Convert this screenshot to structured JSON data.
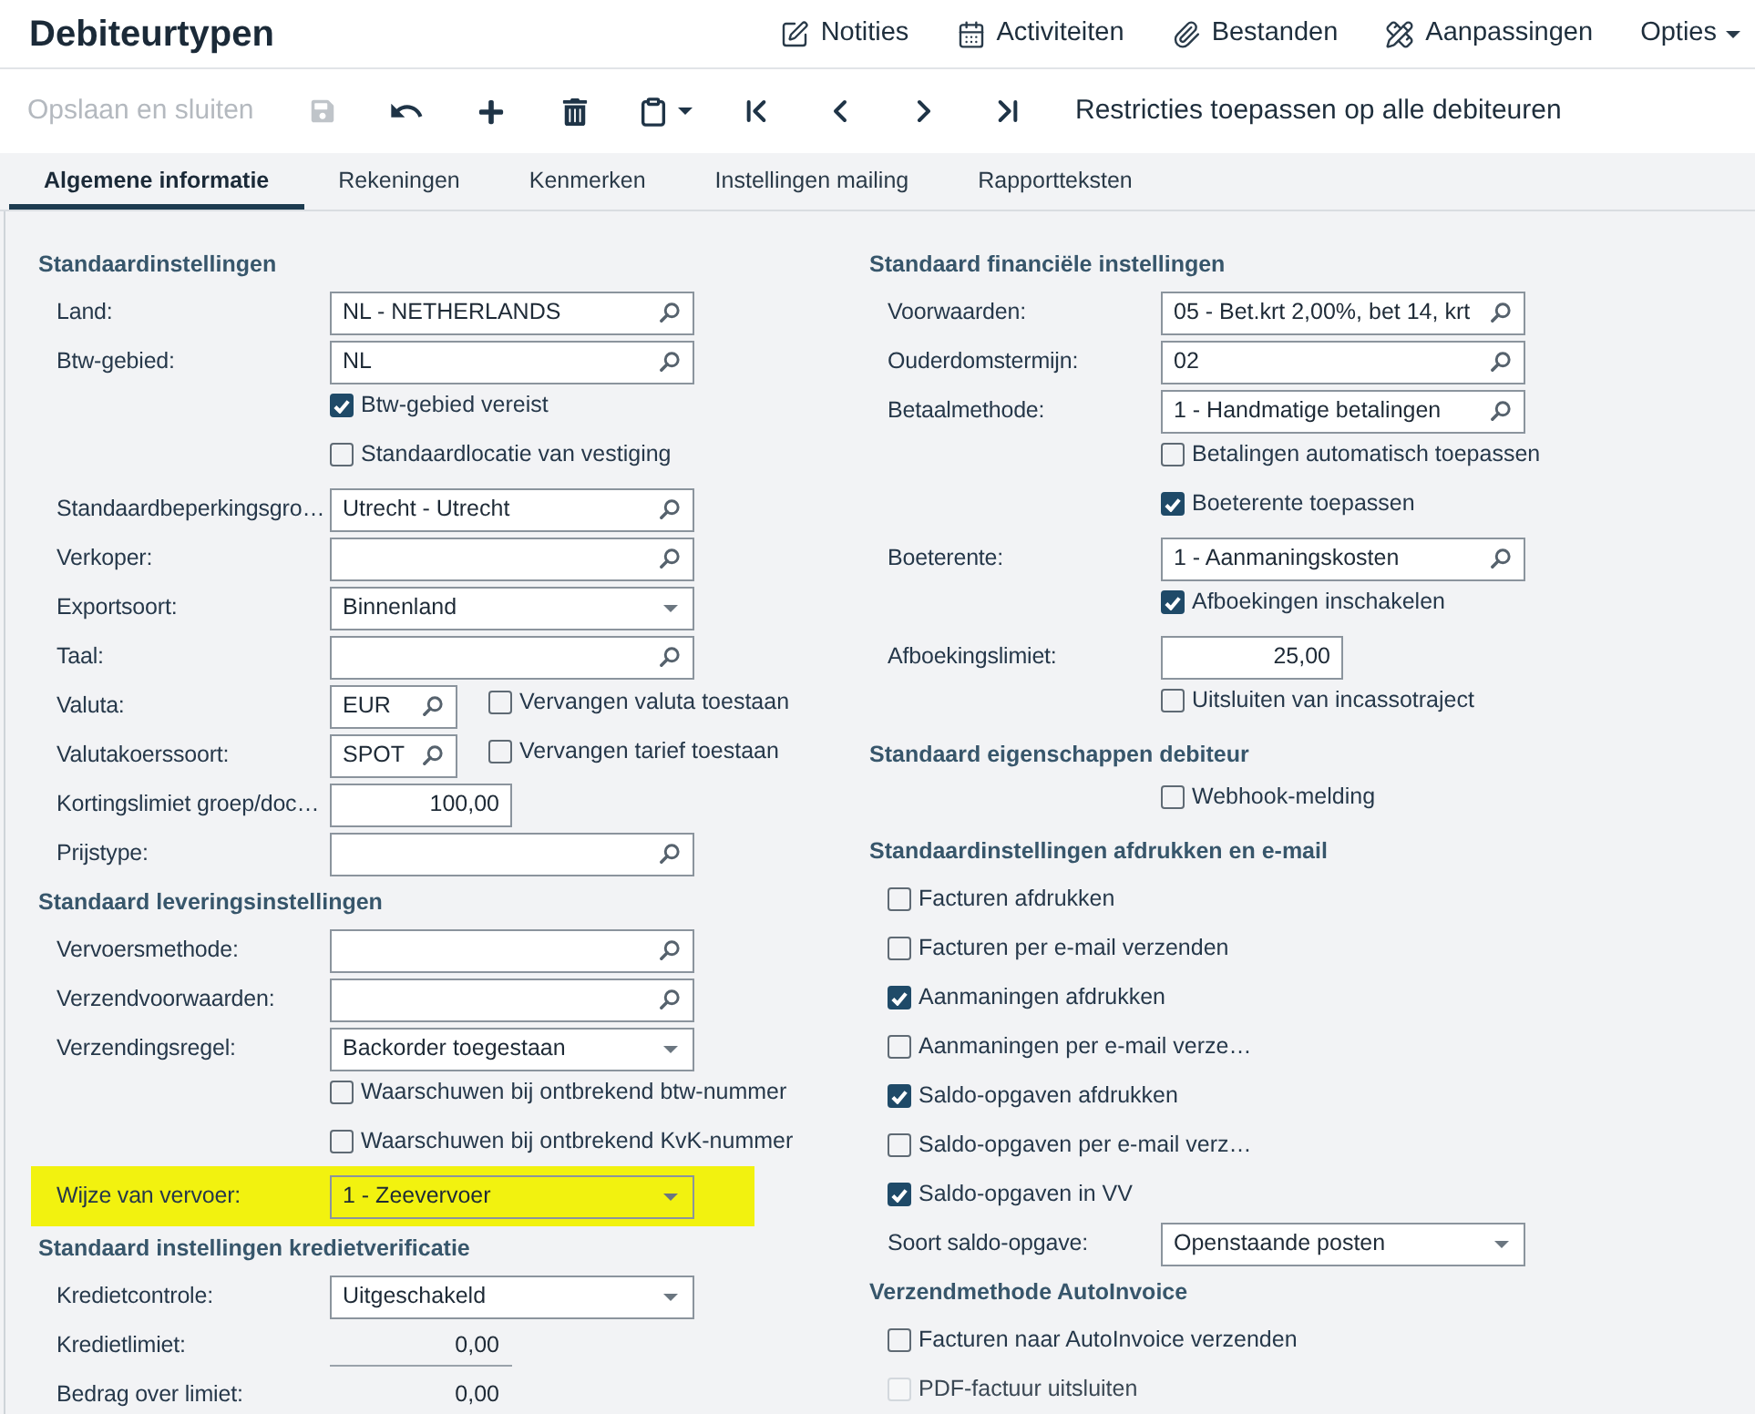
{
  "page": {
    "title": "Debiteurtypen"
  },
  "header_actions": [
    {
      "kind": "link",
      "label": "Notities"
    },
    {
      "kind": "link",
      "label": "Activiteiten"
    },
    {
      "kind": "link",
      "label": "Bestanden"
    },
    {
      "kind": "link",
      "label": "Aanpassingen"
    },
    {
      "kind": "menu",
      "label": "Opties"
    }
  ],
  "toolbar": {
    "save_and_close": {
      "label": "Opslaan en sluiten",
      "disabled": true
    },
    "icon_buttons": [
      {
        "kind": "button",
        "disabled": true
      },
      {
        "kind": "button",
        "disabled": false
      },
      {
        "kind": "button",
        "disabled": false
      },
      {
        "kind": "button",
        "disabled": false
      },
      {
        "kind": "menu",
        "disabled": false
      },
      {
        "kind": "button",
        "disabled": false
      },
      {
        "kind": "button",
        "disabled": false
      },
      {
        "kind": "button",
        "disabled": false
      },
      {
        "kind": "button",
        "disabled": false
      }
    ],
    "action": {
      "label": "Restricties toepassen op alle debiteuren"
    }
  },
  "tabs": [
    {
      "label": "Algemene informatie",
      "selected": true
    },
    {
      "label": "Rekeningen",
      "selected": false
    },
    {
      "label": "Kenmerken",
      "selected": false
    },
    {
      "label": "Instellingen mailing",
      "selected": false
    },
    {
      "label": "Rapportteksten",
      "selected": false
    }
  ],
  "columns": [
    {
      "sections": [
        {
          "title": "Standaardinstellingen",
          "rows": [
            {
              "kind": "lookup",
              "label": "Land:",
              "value": "NL - NETHERLANDS"
            },
            {
              "kind": "lookup",
              "label": "Btw-gebied:",
              "value": "NL"
            },
            {
              "kind": "checkbox",
              "label": "Btw-gebied vereist",
              "checked": true
            },
            {
              "kind": "checkbox",
              "label": "Standaardlocatie van vestiging",
              "checked": false
            },
            {
              "kind": "lookup",
              "label": "Standaardbeperkingsgro…",
              "value": "Utrecht - Utrecht"
            },
            {
              "kind": "lookup",
              "label": "Verkoper:"
            },
            {
              "kind": "select",
              "label": "Exportsoort:",
              "value": "Binnenland"
            },
            {
              "kind": "lookup",
              "label": "Taal:"
            },
            {
              "kind": "lookup_option",
              "label": "Valuta:",
              "value": "EUR",
              "option": {
                "label": "Vervangen valuta toestaan",
                "checked": false
              }
            },
            {
              "kind": "lookup_option",
              "label": "Valutakoerssoort:",
              "value": "SPOT",
              "option": {
                "label": "Vervangen tarief toestaan",
                "checked": false
              }
            },
            {
              "kind": "number",
              "label": "Kortingslimiet groep/doc…",
              "value": "100,00"
            },
            {
              "kind": "lookup",
              "label": "Prijstype:"
            }
          ]
        },
        {
          "title": "Standaard leveringsinstellingen",
          "rows": [
            {
              "kind": "lookup",
              "label": "Vervoersmethode:",
              "highlighted": false
            },
            {
              "kind": "lookup",
              "label": "Verzendvoorwaarden:",
              "highlighted": false
            },
            {
              "kind": "select",
              "label": "Verzendingsregel:",
              "value": "Backorder toegestaan",
              "highlighted": false
            },
            {
              "kind": "checkbox",
              "label": "Waarschuwen bij ontbrekend btw-nummer",
              "checked": false,
              "highlighted": false
            },
            {
              "kind": "checkbox",
              "label": "Waarschuwen bij ontbrekend KvK-nummer",
              "checked": false,
              "highlighted": false
            },
            {
              "kind": "select",
              "label": "Wijze van vervoer:",
              "value": "1 - Zeevervoer",
              "highlighted": true
            }
          ]
        },
        {
          "title": "Standaard instellingen kredietverificatie",
          "rows": [
            {
              "kind": "select",
              "label": "Kredietcontrole:",
              "value": "Uitgeschakeld"
            },
            {
              "kind": "readonly",
              "label": "Kredietlimiet:",
              "value": "0,00"
            },
            {
              "kind": "readonly",
              "label": "Bedrag over limiet:",
              "value": "0,00"
            }
          ]
        }
      ]
    },
    {
      "sections": [
        {
          "title": "Standaard financiële instellingen",
          "rows": [
            {
              "kind": "lookup",
              "label": "Voorwaarden:",
              "value": "05 - Bet.krt 2,00%, bet 14, krt"
            },
            {
              "kind": "lookup",
              "label": "Ouderdomstermijn:",
              "value": "02"
            },
            {
              "kind": "lookup",
              "label": "Betaalmethode:",
              "value": "1 - Handmatige betalingen"
            },
            {
              "kind": "checkbox",
              "label": "Betalingen automatisch toepassen",
              "checked": false
            },
            {
              "kind": "checkbox",
              "label": "Boeterente toepassen",
              "checked": true
            },
            {
              "kind": "lookup",
              "label": "Boeterente:",
              "value": "1 - Aanmaningskosten"
            },
            {
              "kind": "checkbox",
              "label": "Afboekingen inschakelen",
              "checked": true
            },
            {
              "kind": "number",
              "label": "Afboekingslimiet:",
              "value": "25,00"
            },
            {
              "kind": "checkbox",
              "label": "Uitsluiten van incassotraject",
              "checked": false
            }
          ]
        },
        {
          "title": "Standaard eigenschappen debiteur",
          "rows": [
            {
              "kind": "checkbox",
              "label": "Webhook-melding",
              "checked": false
            }
          ]
        },
        {
          "title": "Standaardinstellingen afdrukken en e-mail",
          "rows": [
            {
              "kind": "option",
              "label": "Facturen afdrukken",
              "checked": false
            },
            {
              "kind": "option",
              "label": "Facturen per e-mail verzenden",
              "checked": false
            },
            {
              "kind": "option",
              "label": "Aanmaningen afdrukken",
              "checked": true
            },
            {
              "kind": "option",
              "label": "Aanmaningen per e-mail verze…",
              "checked": false
            },
            {
              "kind": "option",
              "label": "Saldo-opgaven afdrukken",
              "checked": true
            },
            {
              "kind": "option",
              "label": "Saldo-opgaven per e-mail verz…",
              "checked": false
            },
            {
              "kind": "option",
              "label": "Saldo-opgaven in VV",
              "checked": true
            },
            {
              "kind": "select",
              "label": "Soort saldo-opgave:",
              "value": "Openstaande posten"
            }
          ]
        },
        {
          "title": "Verzendmethode AutoInvoice",
          "rows": [
            {
              "kind": "option",
              "label": "Facturen naar AutoInvoice verzenden",
              "checked": false,
              "disabled": false
            },
            {
              "kind": "option",
              "label": "PDF-factuur uitsluiten",
              "checked": false,
              "disabled": true
            }
          ]
        }
      ]
    }
  ]
}
